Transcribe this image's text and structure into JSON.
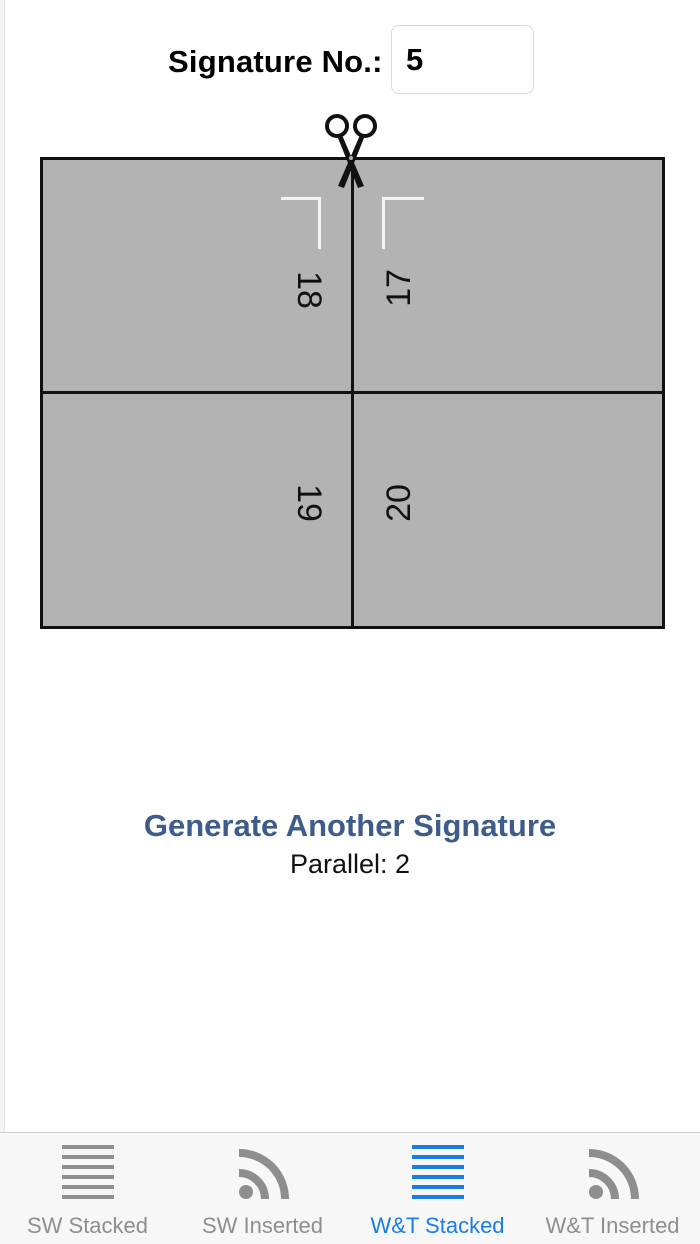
{
  "signature": {
    "label": "Signature No.:",
    "value": "5"
  },
  "diagram": {
    "pages": {
      "top_left": "18",
      "top_right": "17",
      "bottom_left": "19",
      "bottom_right": "20"
    },
    "icons": {
      "cut_marker": "scissors-icon"
    }
  },
  "actions": {
    "generate_label": "Generate Another Signature",
    "parallel_text": "Parallel: 2",
    "generate_color": "#3d5c8c"
  },
  "tabbar": {
    "active_color": "#1a7de6",
    "inactive_color": "#8e8e8e",
    "tabs": [
      {
        "label": "SW Stacked",
        "icon": "stacked-lines-icon",
        "active": false
      },
      {
        "label": "SW Inserted",
        "icon": "inserted-arcs-icon",
        "active": false
      },
      {
        "label": "W&T Stacked",
        "icon": "stacked-lines-icon",
        "active": true
      },
      {
        "label": "W&T Inserted",
        "icon": "inserted-arcs-icon",
        "active": false
      }
    ]
  }
}
